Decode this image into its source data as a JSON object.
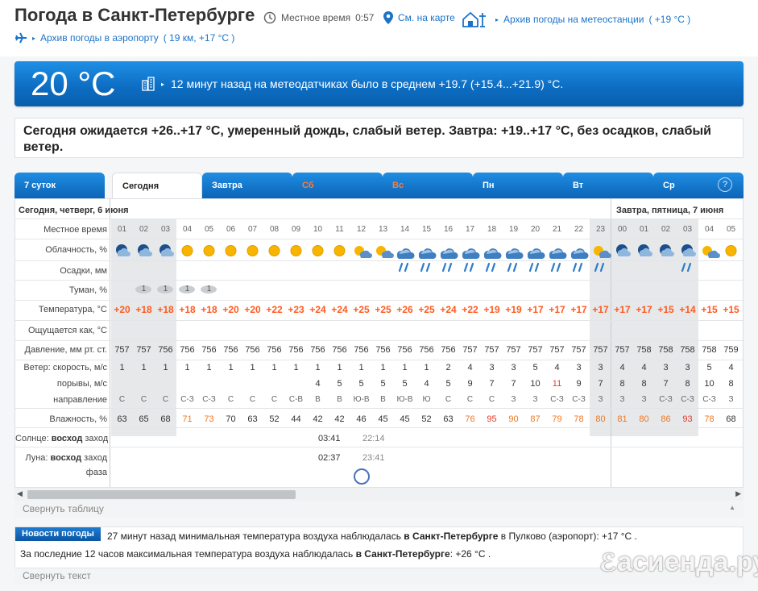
{
  "header": {
    "title": "Погода в Санкт-Петербурге",
    "local_time_label": "Местное время",
    "local_time": "0:57",
    "map_link": "См. на карте",
    "station_archive": "Архив погоды на метеостанции",
    "station_temp": "( +19 °C )",
    "airport_archive": "Архив погоды в аэропорту",
    "airport_info": "( 19 км, +17 °C )"
  },
  "current": {
    "temp": "20 °C",
    "note": "12 минут назад на метеодатчиках было в среднем +19.7 (+15.4...+21.9) °C."
  },
  "forecast_text": "Сегодня ожидается +26..+17 °C, умеренный дождь, слабый ветер. Завтра: +19..+17 °C, без осадков, слабый ветер.",
  "tabs": [
    {
      "label": "7 суток",
      "weekend": false
    },
    {
      "label": "Сегодня",
      "weekend": false,
      "active": true
    },
    {
      "label": "Завтра",
      "weekend": false
    },
    {
      "label": "Сб",
      "weekend": true
    },
    {
      "label": "Вс",
      "weekend": true
    },
    {
      "label": "Пн",
      "weekend": false
    },
    {
      "label": "Вт",
      "weekend": false
    },
    {
      "label": "Ср",
      "weekend": false
    }
  ],
  "help_label": "?",
  "table": {
    "day1_label": "Сегодня, четверг, 6 июня",
    "day2_label": "Завтра, пятница, 7 июня",
    "row_labels": {
      "time": "Местное время",
      "clouds": "Облачность, %",
      "precip": "Осадки, мм",
      "fog": "Туман, %",
      "temp": "Температура, °C",
      "feels": "Ощущается как, °C",
      "pressure": "Давление, мм рт. ст.",
      "wind_speed": "Ветер: скорость, м/с",
      "gusts": "порывы, м/с",
      "direction": "направление",
      "humidity": "Влажность, %",
      "sun_prefix": "Солнце:",
      "sun_rise": "восход",
      "sun_set": "заход",
      "moon_prefix": "Луна:",
      "moon_rise": "восход",
      "moon_set": "заход",
      "phase": "фаза"
    },
    "hours": [
      "01",
      "02",
      "03",
      "04",
      "05",
      "06",
      "07",
      "08",
      "09",
      "10",
      "11",
      "12",
      "13",
      "14",
      "15",
      "16",
      "17",
      "18",
      "19",
      "20",
      "21",
      "22",
      "23",
      "00",
      "01",
      "02",
      "03",
      "04",
      "05"
    ],
    "clouds": [
      "night-cloud",
      "night-cloud",
      "night-cloud",
      "sun",
      "sun",
      "sun",
      "sun",
      "sun",
      "sun",
      "sun",
      "sun",
      "sun-cloud",
      "sun-cloud",
      "cloudy",
      "cloudy",
      "cloudy",
      "cloudy",
      "cloudy",
      "cloudy",
      "cloudy",
      "cloudy",
      "cloudy",
      "sun-cloud",
      "night-cloud",
      "night-cloud",
      "night-cloud",
      "night-cloud",
      "sun-cloud",
      "sun"
    ],
    "rain_hours": [
      13,
      14,
      15,
      16,
      17,
      18,
      19,
      20,
      21,
      22,
      26
    ],
    "fog_label": "1",
    "fog_hours": [
      1,
      2,
      3,
      4
    ],
    "temps": [
      "+20",
      "+18",
      "+18",
      "+18",
      "+18",
      "+20",
      "+20",
      "+22",
      "+23",
      "+24",
      "+24",
      "+25",
      "+25",
      "+26",
      "+25",
      "+24",
      "+22",
      "+19",
      "+19",
      "+17",
      "+17",
      "+17",
      "+17",
      "+17",
      "+17",
      "+15",
      "+14",
      "+15",
      "+15"
    ],
    "pressure": [
      "757",
      "757",
      "756",
      "756",
      "756",
      "756",
      "756",
      "756",
      "756",
      "756",
      "756",
      "756",
      "756",
      "756",
      "756",
      "756",
      "757",
      "757",
      "757",
      "757",
      "757",
      "757",
      "757",
      "757",
      "758",
      "758",
      "758",
      "758",
      "759"
    ],
    "wind": [
      "1",
      "1",
      "1",
      "1",
      "1",
      "1",
      "1",
      "1",
      "1",
      "1",
      "1",
      "1",
      "1",
      "1",
      "1",
      "2",
      "4",
      "3",
      "3",
      "5",
      "4",
      "3",
      "3",
      "4",
      "4",
      "3",
      "3",
      "5",
      "4"
    ],
    "gusts": [
      "",
      "",
      "",
      "",
      "",
      "",
      "",
      "",
      "",
      "4",
      "5",
      "5",
      "5",
      "5",
      "4",
      "5",
      "9",
      "7",
      "7",
      "10",
      "11",
      "9",
      "7",
      "8",
      "8",
      "7",
      "8",
      "10",
      "8"
    ],
    "gusts_red": [
      20
    ],
    "directions": [
      "С",
      "С",
      "С",
      "С-З",
      "С-З",
      "С",
      "С",
      "С",
      "С-В",
      "В",
      "В",
      "Ю-В",
      "В",
      "Ю-В",
      "Ю",
      "С",
      "С",
      "С",
      "З",
      "З",
      "С-З",
      "С-З",
      "З",
      "З",
      "З",
      "С-З",
      "С-З",
      "С-З",
      "З"
    ],
    "humidity": [
      "63",
      "65",
      "68",
      "71",
      "73",
      "70",
      "63",
      "52",
      "44",
      "42",
      "42",
      "46",
      "45",
      "45",
      "52",
      "63",
      "76",
      "95",
      "90",
      "87",
      "79",
      "78",
      "80",
      "81",
      "80",
      "86",
      "93",
      "78",
      "68"
    ],
    "humidity_colors": [
      "n",
      "n",
      "n",
      "o",
      "o",
      "n",
      "n",
      "n",
      "n",
      "n",
      "n",
      "n",
      "n",
      "n",
      "n",
      "n",
      "o",
      "r",
      "o",
      "o",
      "o",
      "o",
      "o",
      "o",
      "o",
      "o",
      "r",
      "o",
      "n"
    ],
    "sunrise": "03:41",
    "sunset": "22:14",
    "moonrise": "02:37",
    "moonset": "23:41"
  },
  "collapse_table": "Свернуть таблицу",
  "news": {
    "badge": "Новости погоды",
    "line1_pre": "27 минут назад минимальная температура воздуха наблюдалась",
    "line1_city": "в Санкт-Петербурге",
    "line1_post": "в Пулково (аэропорт): +17 °С .",
    "line2_pre": "За последние 12 часов максимальная температура воздуха наблюдалась",
    "line2_city": "в Санкт-Петербурге",
    "line2_post": ": +26 °С ."
  },
  "collapse_text": "Свернуть текст",
  "watermark": "асиенда.ру",
  "colors": {
    "accent_blue": "#0c6cc1",
    "temp_orange": "#ff5a1f",
    "humidity_red": "#e23b2d",
    "humidity_orange": "#f07722"
  }
}
